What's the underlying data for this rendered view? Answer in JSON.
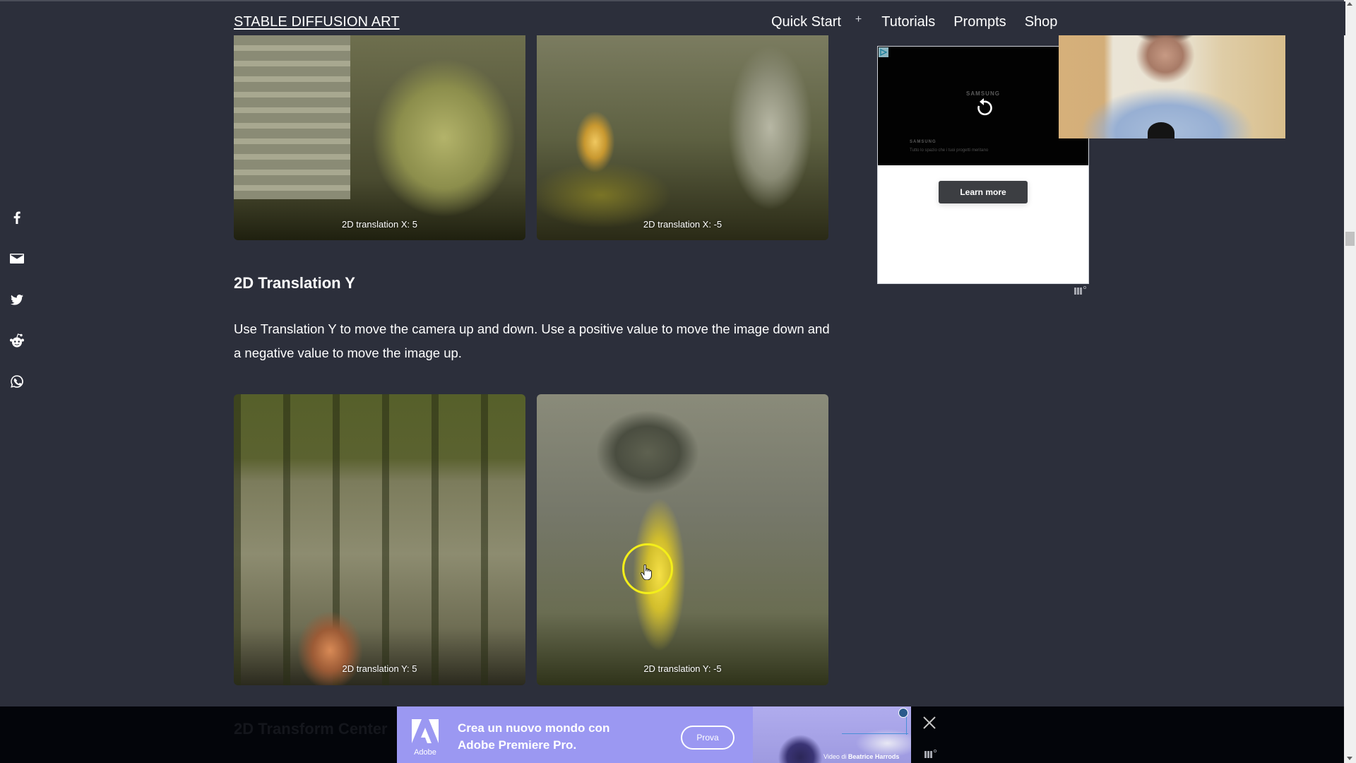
{
  "header": {
    "site_title": "STABLE DIFFUSION ART",
    "nav": [
      {
        "label": "Quick Start"
      },
      {
        "label": "+"
      },
      {
        "label": "Tutorials"
      },
      {
        "label": "Prompts"
      },
      {
        "label": "Shop"
      }
    ]
  },
  "social": [
    {
      "icon": "facebook-icon"
    },
    {
      "icon": "email-icon"
    },
    {
      "icon": "twitter-icon"
    },
    {
      "icon": "reddit-icon"
    },
    {
      "icon": "whatsapp-icon"
    }
  ],
  "gallery_x": {
    "images": [
      {
        "caption": "2D translation X: 5"
      },
      {
        "caption": "2D translation X: -5"
      }
    ]
  },
  "section": {
    "title": "2D Translation Y",
    "text": "Use Translation Y to move the camera up and down. Use a positive value to move the image down and a negative value to move the image up."
  },
  "gallery_y": {
    "images": [
      {
        "caption": "2D translation Y: 5"
      },
      {
        "caption": "2D translation Y: -5"
      }
    ]
  },
  "next_section": {
    "title": "2D Transform Center"
  },
  "side_ad": {
    "brand": "SAMSUNG",
    "tagline": "Tutto lo spazio che i tuoi progetti meritano",
    "button_label": "Learn more"
  },
  "bottom_ad": {
    "brand": "Adobe",
    "line1": "Crea un nuovo mondo con",
    "line2": "Adobe Premiere Pro.",
    "cta_label": "Prova",
    "credit_prefix": "Video di",
    "credit_name": "Beatrice Harrods"
  }
}
